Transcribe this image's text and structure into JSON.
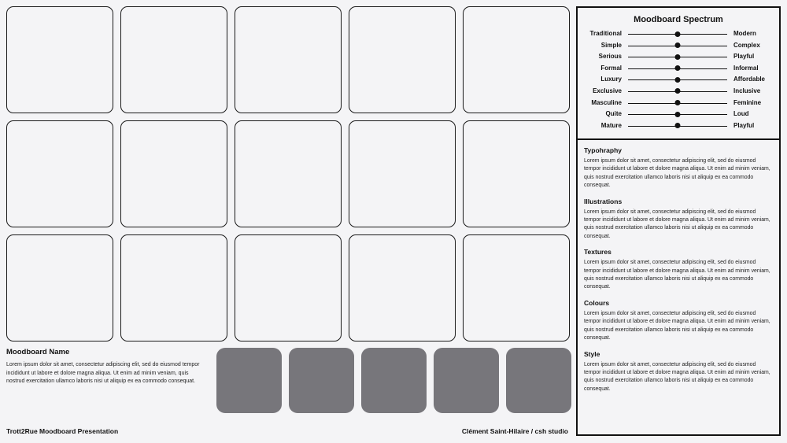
{
  "tiles_rows": 3,
  "tiles_cols": 5,
  "moodboard": {
    "name": "Moodboard Name",
    "description": "Lorem ipsum dolor sit amet, consectetur adipiscing elit, sed do eiusmod tempor incididunt ut labore et dolore magna aliqua. Ut enim ad minim veniam, quis nostrud exercitation ullamco laboris nisi ut aliquip ex ea commodo consequat."
  },
  "swatches": [
    "#77767b",
    "#77767b",
    "#77767b",
    "#77767b",
    "#77767b"
  ],
  "footer": {
    "left": "Trott2Rue Moodboard Presentation",
    "right": "Clément Saint-Hilaire / csh studio"
  },
  "spectrum": {
    "title": "Moodboard Spectrum",
    "rows": [
      {
        "left": "Traditional",
        "right": "Modern",
        "level": 0.5
      },
      {
        "left": "Simple",
        "right": "Complex",
        "level": 0.5
      },
      {
        "left": "Serious",
        "right": "Playful",
        "level": 0.5
      },
      {
        "left": "Formal",
        "right": "Informal",
        "level": 0.5
      },
      {
        "left": "Luxury",
        "right": "Affordable",
        "level": 0.5
      },
      {
        "left": "Exclusive",
        "right": "Inclusive",
        "level": 0.5
      },
      {
        "left": "Masculine",
        "right": "Feminine",
        "level": 0.5
      },
      {
        "left": "Quite",
        "right": "Loud",
        "level": 0.5
      },
      {
        "left": "Mature",
        "right": "Playful",
        "level": 0.5
      }
    ]
  },
  "notes": [
    {
      "title": "Typohraphy",
      "text": "Lorem ipsum dolor sit amet, consectetur adipiscing elit, sed do eiusmod tempor incididunt ut labore et dolore magna aliqua. Ut enim ad minim veniam, quis nostrud exercitation ullamco laboris nisi ut aliquip ex ea commodo consequat."
    },
    {
      "title": "Illustrations",
      "text": "Lorem ipsum dolor sit amet, consectetur adipiscing elit, sed do eiusmod tempor incididunt ut labore et dolore magna aliqua. Ut enim ad minim veniam, quis nostrud exercitation ullamco laboris nisi ut aliquip ex ea commodo consequat."
    },
    {
      "title": "Textures",
      "text": "Lorem ipsum dolor sit amet, consectetur adipiscing elit, sed do eiusmod tempor incididunt ut labore et dolore magna aliqua. Ut enim ad minim veniam, quis nostrud exercitation ullamco laboris nisi ut aliquip ex ea commodo consequat."
    },
    {
      "title": "Colours",
      "text": "Lorem ipsum dolor sit amet, consectetur adipiscing elit, sed do eiusmod tempor incididunt ut labore et dolore magna aliqua. Ut enim ad minim veniam, quis nostrud exercitation ullamco laboris nisi ut aliquip ex ea commodo consequat."
    },
    {
      "title": "Style",
      "text": "Lorem ipsum dolor sit amet, consectetur adipiscing elit, sed do eiusmod tempor incididunt ut labore et dolore magna aliqua. Ut enim ad minim veniam, quis nostrud exercitation ullamco laboris nisi ut aliquip ex ea commodo consequat."
    }
  ]
}
